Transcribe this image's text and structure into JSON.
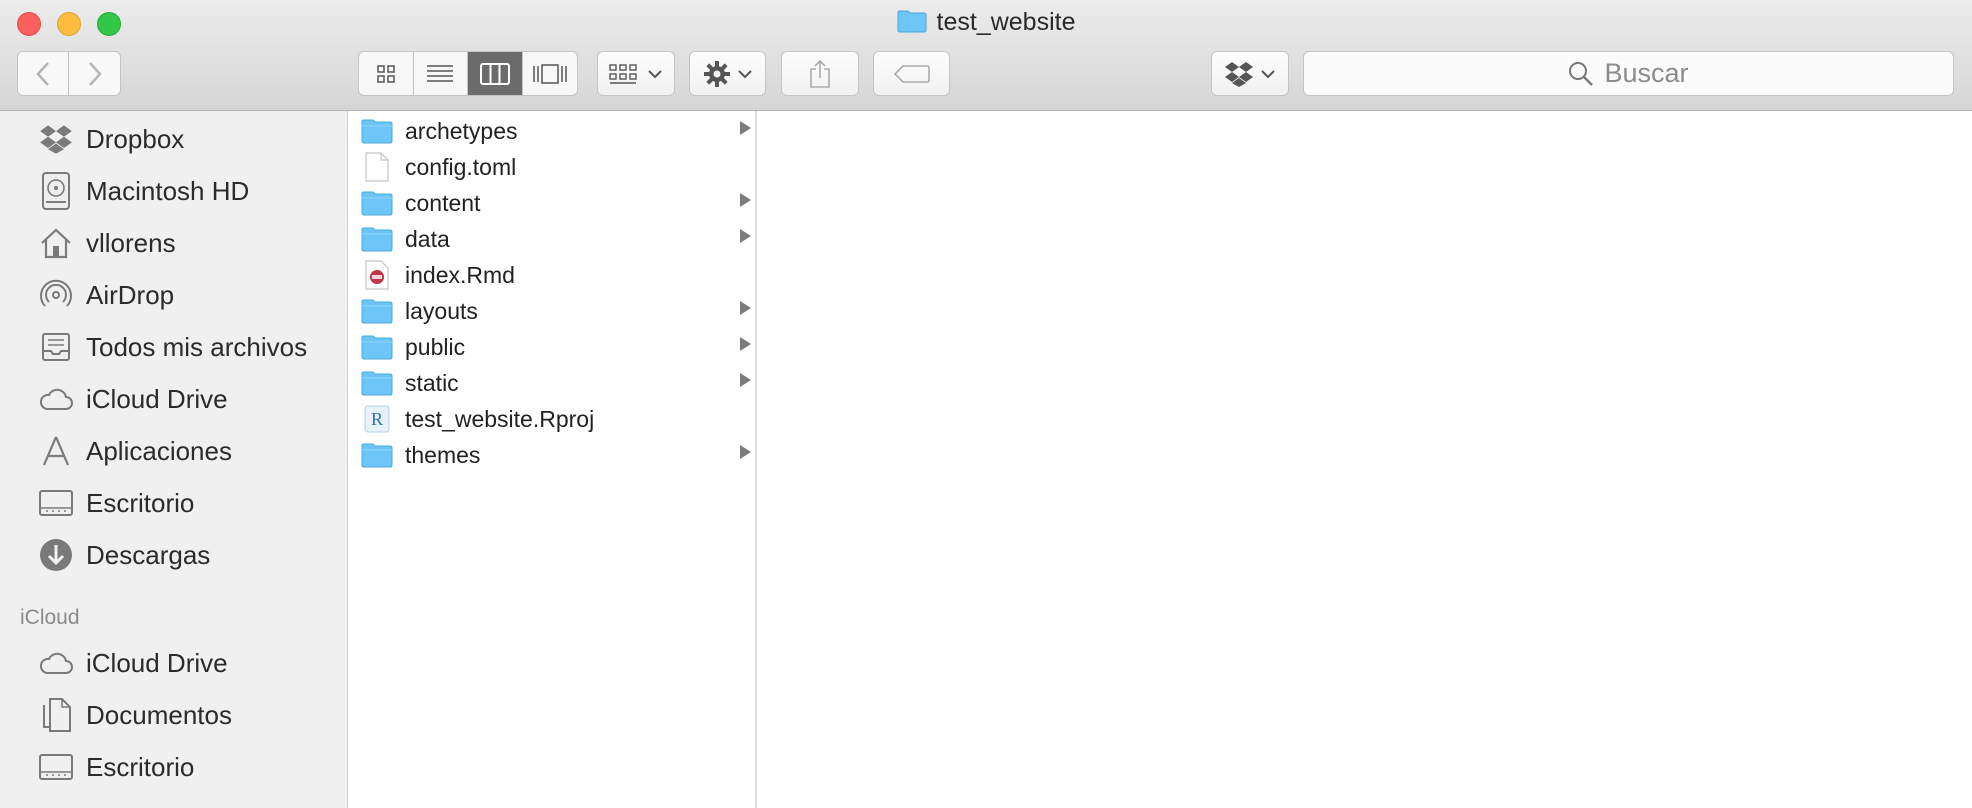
{
  "window": {
    "title": "test_website"
  },
  "search": {
    "placeholder": "Buscar"
  },
  "sidebar": {
    "favorites": [
      {
        "label": "Dropbox",
        "icon": "dropbox-icon"
      },
      {
        "label": "Macintosh HD",
        "icon": "hard-drive-icon"
      },
      {
        "label": "vllorens",
        "icon": "home-icon"
      },
      {
        "label": "AirDrop",
        "icon": "airdrop-icon"
      },
      {
        "label": "Todos mis archivos",
        "icon": "all-files-icon"
      },
      {
        "label": "iCloud Drive",
        "icon": "cloud-icon"
      },
      {
        "label": "Aplicaciones",
        "icon": "applications-icon"
      },
      {
        "label": "Escritorio",
        "icon": "desktop-icon"
      },
      {
        "label": "Descargas",
        "icon": "downloads-icon"
      }
    ],
    "icloud_header": "iCloud",
    "icloud": [
      {
        "label": "iCloud Drive",
        "icon": "cloud-icon"
      },
      {
        "label": "Documentos",
        "icon": "documents-icon"
      },
      {
        "label": "Escritorio",
        "icon": "desktop-icon"
      }
    ]
  },
  "files": [
    {
      "name": "archetypes",
      "type": "folder"
    },
    {
      "name": "config.toml",
      "type": "file"
    },
    {
      "name": "content",
      "type": "folder"
    },
    {
      "name": "data",
      "type": "folder"
    },
    {
      "name": "index.Rmd",
      "type": "rmd"
    },
    {
      "name": "layouts",
      "type": "folder"
    },
    {
      "name": "public",
      "type": "folder"
    },
    {
      "name": "static",
      "type": "folder"
    },
    {
      "name": "test_website.Rproj",
      "type": "rproj"
    },
    {
      "name": "themes",
      "type": "folder"
    }
  ],
  "colors": {
    "folder": "#6ec6f8",
    "accent": "#6b6b6b"
  }
}
